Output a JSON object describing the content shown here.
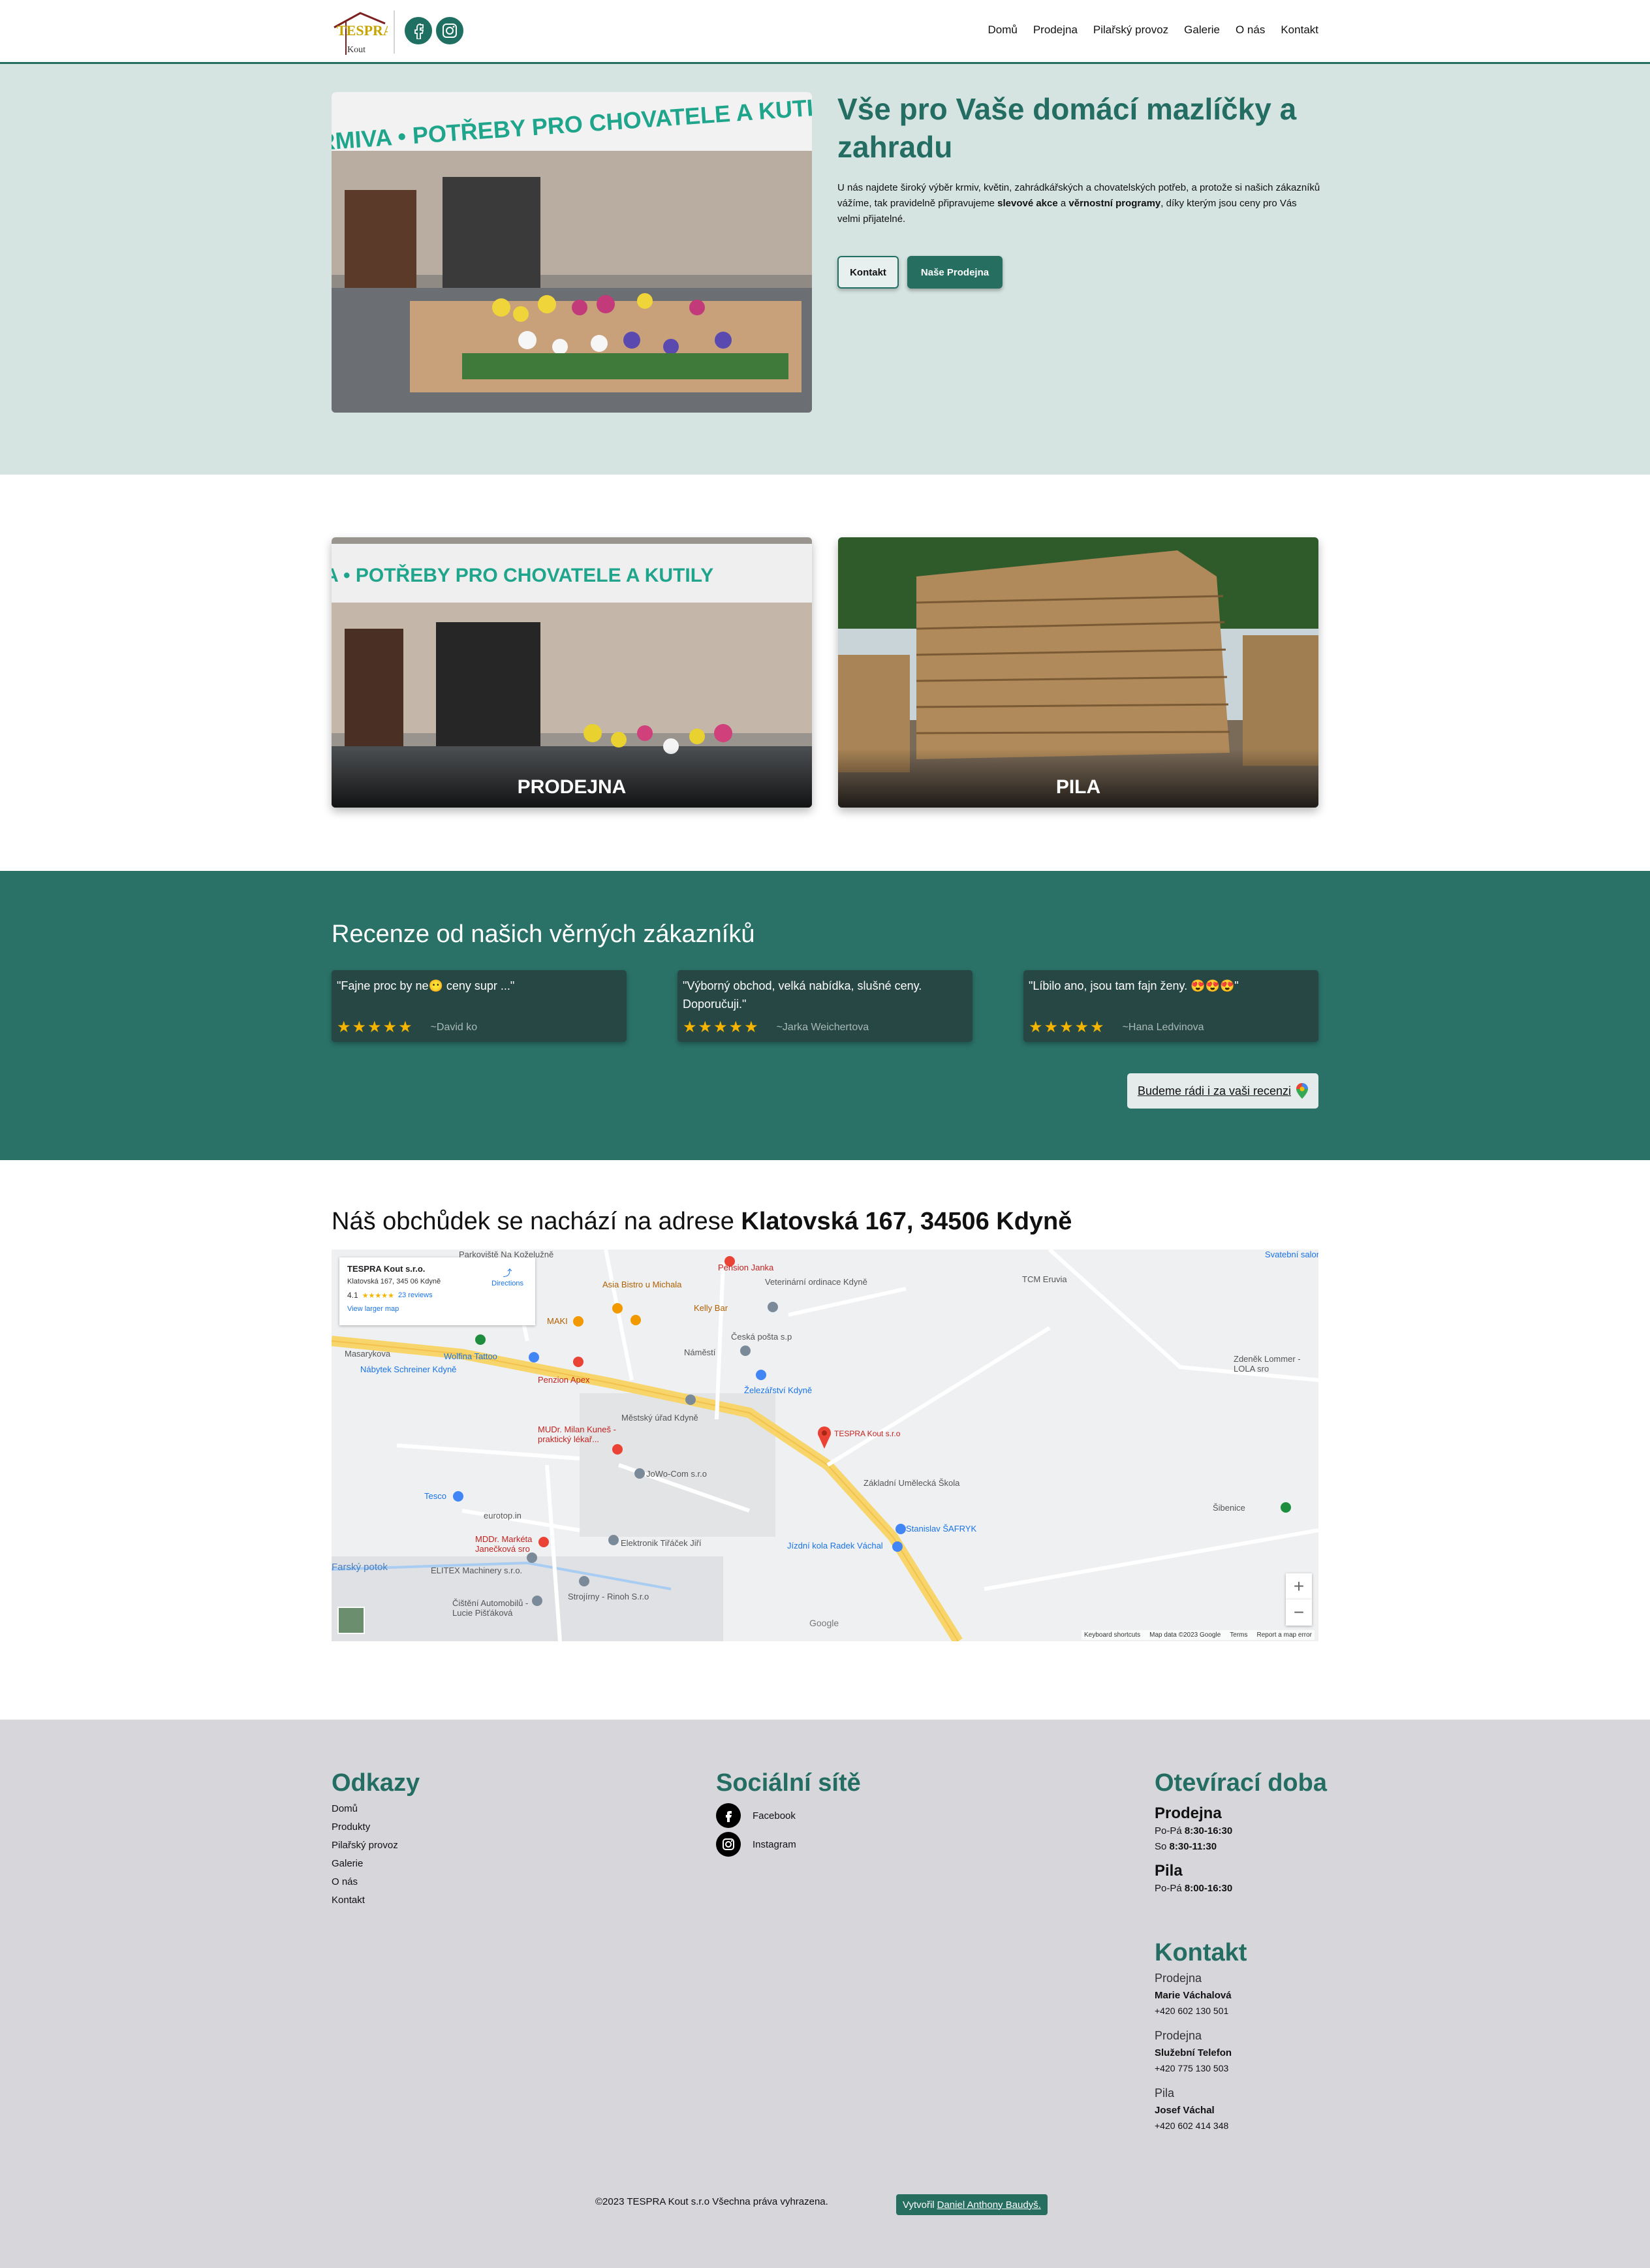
{
  "header": {
    "logo_text_top": "TESPRA",
    "logo_text_bottom": "Kout",
    "nav": [
      "Domů",
      "Prodejna",
      "Pilařský provoz",
      "Galerie",
      "O nás",
      "Kontakt"
    ]
  },
  "hero": {
    "sign_text": "KRMIVA • POTŘEBY PRO CHOVATELE A KUTILY",
    "title": "Vše pro Vaše domácí mazlíčky a zahradu",
    "text_1": "U nás najdete široký výběr krmiv, květin, zahrádkářských a chovatelských potřeb, a protože si našich zákazníků vážíme, tak pravidelně připravujeme ",
    "text_bold_1": "slevové akce",
    "text_2": " a ",
    "text_bold_2": "věrnostní programy",
    "text_3": ", díky kterým jsou ceny pro Vás velmi přijatelné.",
    "btn_contact": "Kontakt",
    "btn_shop": "Naše Prodejna"
  },
  "cards": [
    {
      "label": "PRODEJNA",
      "sign_text": "KRMIVA • POTŘEBY PRO CHOVATELE A KUTILY"
    },
    {
      "label": "PILA"
    }
  ],
  "reviews": {
    "title": "Recenze od našich věrných zákazníků",
    "items": [
      {
        "text": "\"Fajne proc by ne😶 ceny supr ...\"",
        "stars": "★★★★★",
        "author": "~David ko"
      },
      {
        "text": "\"Výborný obchod, velká nabídka, slušné ceny. Doporučuji.\"",
        "stars": "★★★★★",
        "author": "~Jarka Weichertova"
      },
      {
        "text": "\"Líbilo ano, jsou tam fajn ženy. 😍😍😍\"",
        "stars": "★★★★★",
        "author": "~Hana Ledvinova"
      }
    ],
    "cta": "Budeme rádi i za vaši recenzi"
  },
  "address": {
    "prefix": "Náš obchůdek se nachází na adrese ",
    "bold": "Klatovská 167, 34506 Kdyně"
  },
  "map": {
    "card_title": "TESPRA Kout s.r.o.",
    "card_address": "Klatovská 167, 345 06 Kdyně",
    "card_rating": "4.1",
    "card_stars": "★★★★★",
    "card_reviews": "23 reviews",
    "card_directions": "Directions",
    "card_larger": "View larger map",
    "pin_label": "TESPRA Kout s.r.o",
    "labels": [
      "Parkoviště Na Koželužně",
      "Pension Janka",
      "Asia Bistro u Michala",
      "Veterinární ordinace Kdyně",
      "Kelly Bar",
      "MAKI",
      "Česká pošta s.p",
      "Náměstí",
      "Wolfina Tattoo",
      "Nábytek Schreiner Kdyně",
      "Penzion Apex",
      "Železářství Kdyně",
      "Městský úřad Kdyně",
      "MUDr. Milan Kuneš - praktický lékař...",
      "JoWo-Com s.r.o",
      "Základní Umělecká Škola",
      "Tesco",
      "eurotop.in",
      "Stanislav ŠAFRYK",
      "MDDr. Markéta Janečková sro",
      "Elektronik Tiřáček Jiří",
      "Jízdní kola Radek Váchal",
      "ELITEX Machinery s.r.o.",
      "Strojírny - Rinoh S.r.o",
      "Čištění Automobilů - Lucie Pišťáková",
      "TCM Eruvia",
      "Zdeněk Lommer - LOLA sro",
      "Šibenice",
      "Svatební salon",
      "Masarykova",
      "Farský potok",
      "Google"
    ],
    "footer": [
      "Keyboard shortcuts",
      "Map data ©2023 Google",
      "Terms",
      "Report a map error"
    ]
  },
  "footer": {
    "links_title": "Odkazy",
    "links": [
      "Domů",
      "Produkty",
      "Pilařský provoz",
      "Galerie",
      "O nás",
      "Kontakt"
    ],
    "social_title": "Sociální sítě",
    "social": [
      "Facebook",
      "Instagram"
    ],
    "hours_title": "Otevírací doba",
    "shop_title": "Prodejna",
    "shop_line1_prefix": "Po-Pá ",
    "shop_line1_time": "8:30-16:30",
    "shop_line2_prefix": "So ",
    "shop_line2_time": "8:30-11:30",
    "saw_title": "Pila",
    "saw_line_prefix": "Po-Pá ",
    "saw_line_time": "8:00-16:30",
    "contact_title": "Kontakt",
    "contacts": [
      {
        "place": "Prodejna",
        "name": "Marie Váchalová",
        "phone": "+420 602 130 501"
      },
      {
        "place": "Prodejna",
        "name": "Služební Telefon",
        "phone": "+420 775 130 503"
      },
      {
        "place": "Pila",
        "name": "Josef Váchal",
        "phone": "+420 602 414 348"
      }
    ],
    "copyright": "©2023 TESPRA Kout s.r.o Všechna práva vyhrazena.",
    "credit_prefix": "Vytvořil",
    "credit_name": "Daniel Anthony Baudyš."
  }
}
